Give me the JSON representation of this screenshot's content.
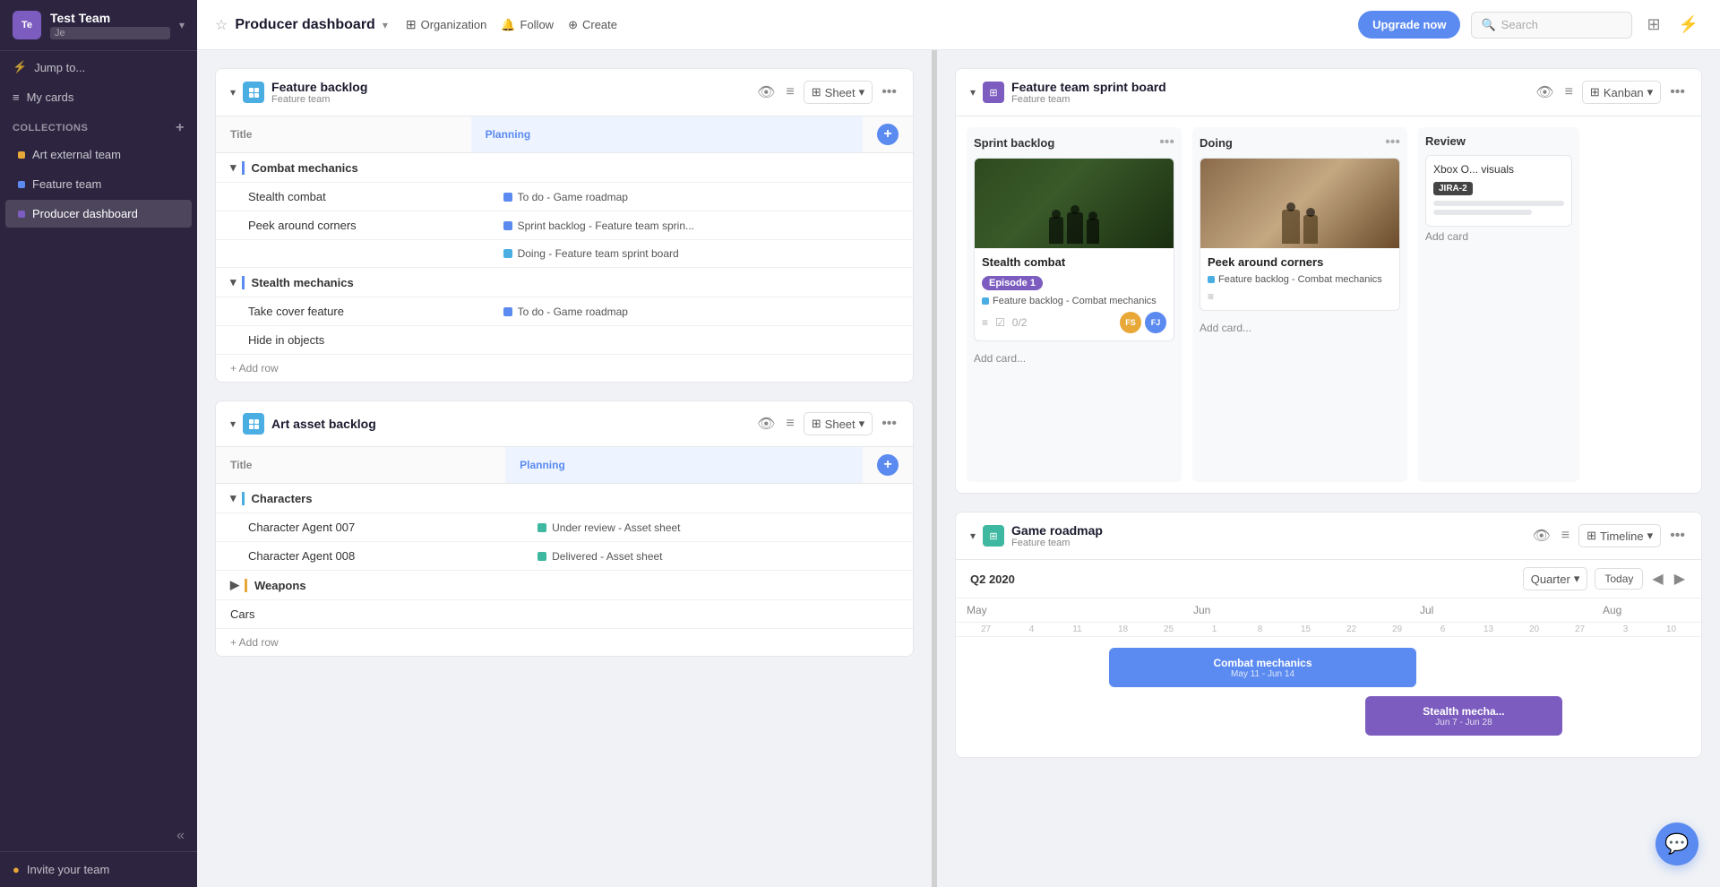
{
  "sidebar": {
    "team_avatar": "Te",
    "team_name": "Test Team",
    "team_name_sub": "Je",
    "jump_to": "Jump to...",
    "my_cards": "My cards",
    "collections_label": "Collections",
    "collections_add": "+",
    "items": [
      {
        "id": "art-external-team",
        "label": "Art external team",
        "color": "#e8a838"
      },
      {
        "id": "feature-team",
        "label": "Feature team",
        "color": "#5b8af0"
      },
      {
        "id": "producer-dashboard",
        "label": "Producer dashboard",
        "color": "#7c5cbf",
        "active": true
      }
    ],
    "invite_your_team": "Invite your team",
    "collapse_icon": "«"
  },
  "topbar": {
    "title": "Producer dashboard",
    "star_icon": "★",
    "org_label": "Organization",
    "follow_label": "Follow",
    "create_label": "Create",
    "upgrade_btn": "Upgrade now",
    "search_placeholder": "Search",
    "grid_icon": "⊞",
    "activity_icon": "⚡"
  },
  "feature_backlog": {
    "title": "Feature backlog",
    "subtitle": "Feature team",
    "view_label": "Sheet",
    "col_title": "Title",
    "col_planning": "Planning",
    "groups": [
      {
        "name": "Combat mechanics",
        "rows": [
          {
            "title": "Stealth combat",
            "planning": "To do - Game roadmap",
            "planning_color": "#5b8af0"
          },
          {
            "title": "Peek around corners",
            "planning": "Sprint backlog - Feature team sprin...",
            "planning_color": "#5b8af0"
          }
        ]
      },
      {
        "name": "Stealth mechanics",
        "rows": [
          {
            "title": "Take cover feature",
            "planning": "",
            "planning_color": ""
          },
          {
            "title": "Hide in objects",
            "planning": "",
            "planning_color": ""
          }
        ]
      }
    ],
    "add_row": "+ Add row",
    "doing_label": "Doing - Feature team sprint board",
    "doing_color": "#4aaee3",
    "todo_color": "#5b8af0"
  },
  "art_asset_backlog": {
    "title": "Art asset backlog",
    "subtitle": "",
    "view_label": "Sheet",
    "col_title": "Title",
    "col_planning": "Planning",
    "groups": [
      {
        "name": "Characters",
        "rows": [
          {
            "title": "Character Agent 007",
            "planning": "Under review - Asset sheet",
            "planning_color": "#3eb8a0"
          },
          {
            "title": "Character Agent 008",
            "planning": "Delivered - Asset sheet",
            "planning_color": "#3eb8a0"
          }
        ]
      },
      {
        "name": "Weapons",
        "rows": []
      }
    ],
    "extra_row": {
      "title": "Cars",
      "planning": ""
    },
    "add_row": "+ Add row"
  },
  "feature_sprint_board": {
    "title": "Feature team sprint board",
    "subtitle": "Feature team",
    "view_label": "Kanban",
    "columns": [
      {
        "id": "sprint-backlog",
        "title": "Sprint backlog",
        "cards": [
          {
            "has_image": true,
            "image_type": "soldiers1",
            "title": "Stealth combat",
            "tag": "Episode 1",
            "tag_color": "#7c5cbf",
            "meta_label": "Feature backlog - Combat mechanics",
            "meta_color": "#4aaee3",
            "checklist": "0/2",
            "avatars": [
              {
                "initials": "FS",
                "color": "#e8a838"
              },
              {
                "initials": "FJ",
                "color": "#5b8af0"
              }
            ]
          }
        ],
        "add_card": "Add card..."
      },
      {
        "id": "doing",
        "title": "Doing",
        "cards": [
          {
            "has_image": true,
            "image_type": "soldiers2",
            "title": "Peek around corners",
            "tag": null,
            "meta_label": "Feature backlog - Combat mechanics",
            "meta_color": "#4aaee3",
            "checklist": null,
            "avatars": []
          }
        ],
        "add_card": "Add card..."
      },
      {
        "id": "review",
        "title": "Review",
        "cards": [
          {
            "has_image": false,
            "title": "Xbox O...",
            "subtitle": "visuals",
            "jira_badge": "JIRA-2",
            "lines": true
          }
        ],
        "add_card": "Add card"
      }
    ]
  },
  "game_roadmap": {
    "title": "Game roadmap",
    "subtitle": "Feature team",
    "view_label": "Timeline",
    "period": "Q2 2020",
    "quarter_selector": "Quarter",
    "today_btn": "Today",
    "months": [
      {
        "label": "May",
        "dates": [
          "27",
          "4",
          "11",
          "18",
          "25"
        ]
      },
      {
        "label": "Jun",
        "dates": [
          "1",
          "8",
          "15",
          "22",
          "29"
        ]
      },
      {
        "label": "Jul",
        "dates": [
          "6",
          "13",
          "20",
          "27"
        ]
      },
      {
        "label": "Aug",
        "dates": [
          "3",
          "10"
        ]
      }
    ],
    "bars": [
      {
        "title": "Combat mechanics",
        "subtitle": "May 11 - Jun 14",
        "color": "#5b8af0",
        "left_pct": 8,
        "width_pct": 40
      },
      {
        "title": "Stealth mecha...",
        "subtitle": "Jun 7 - Jun 28",
        "color": "#7c5cbf",
        "left_pct": 28,
        "width_pct": 26
      }
    ]
  },
  "icons": {
    "star": "☆",
    "bell": "🔔",
    "plus_circle": "⊕",
    "lightning": "⚡",
    "grid": "▦",
    "eye": "👁",
    "filter": "≡",
    "more": "•••",
    "chevron_down": "▾",
    "chevron_right": "▶",
    "chevron_left": "◀",
    "collapse": "«",
    "list": "≡",
    "checkbox": "☑",
    "chat": "💬",
    "coin": "●"
  },
  "colors": {
    "sidebar_bg": "#2d2540",
    "accent_blue": "#5b8af0",
    "accent_purple": "#7c5cbf",
    "accent_teal": "#3eb8a0",
    "accent_orange": "#e8a838",
    "upgrade_btn": "#5b8af0"
  }
}
